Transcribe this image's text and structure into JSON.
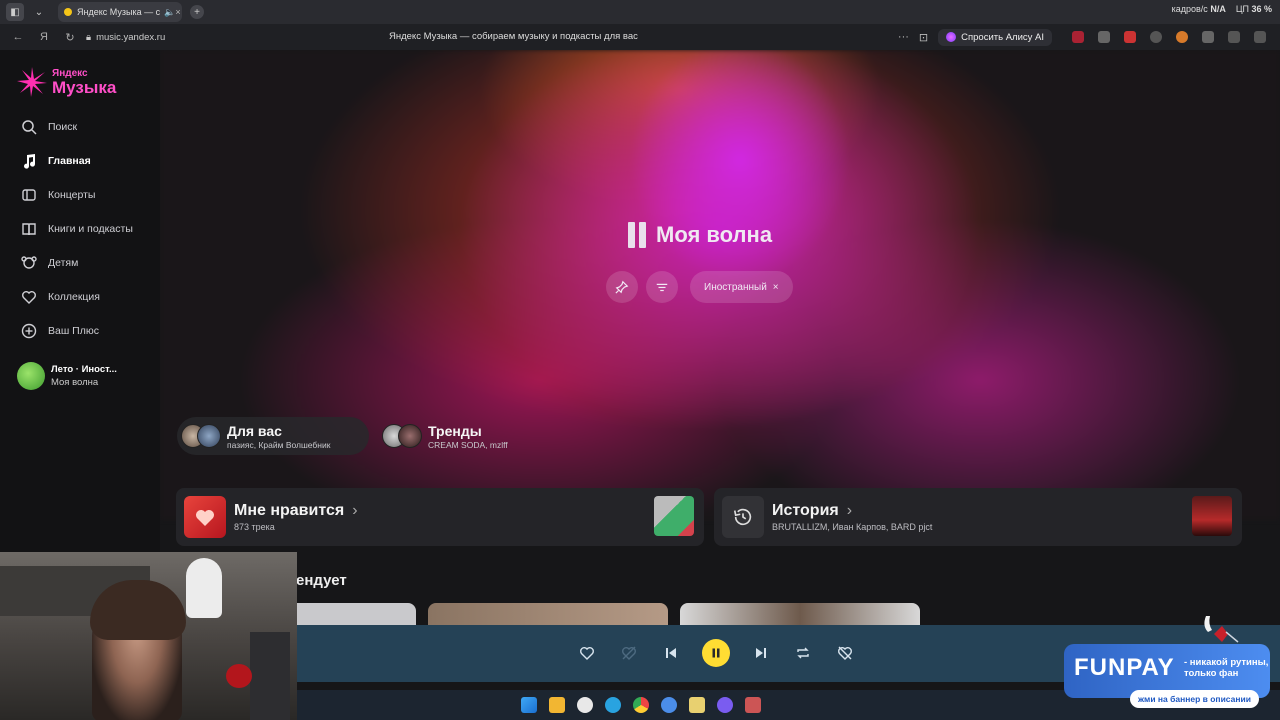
{
  "browser": {
    "tab_title": "Яндекс Музыка — с",
    "new_tab_symbol": "+",
    "sys_fps_label": "кадров/с",
    "sys_fps_value": "N/A",
    "sys_cpu_label": "ЦП",
    "sys_cpu_value": "36 %",
    "url": "music.yandex.ru",
    "page_title": "Яндекс Музыка — собираем музыку и подкасты для вас",
    "more_symbol": "···",
    "ask_alisa": "Спросить Алису AI"
  },
  "logo": {
    "line1": "Яндекс",
    "line2": "Музыка"
  },
  "sidebar": {
    "items": [
      {
        "label": "Поиск",
        "icon": "search-icon",
        "active": false
      },
      {
        "label": "Главная",
        "icon": "music-note-icon",
        "active": true
      },
      {
        "label": "Концерты",
        "icon": "ticket-icon",
        "active": false
      },
      {
        "label": "Книги и подкасты",
        "icon": "book-icon",
        "active": false
      },
      {
        "label": "Детям",
        "icon": "kids-icon",
        "active": false
      },
      {
        "label": "Коллекция",
        "icon": "heart-icon",
        "active": false
      },
      {
        "label": "Ваш Плюс",
        "icon": "plus-icon",
        "active": false
      }
    ],
    "playlist": {
      "title": "Лето · Иност...",
      "subtitle": "Моя волна"
    }
  },
  "wave": {
    "title": "Моя волна",
    "chip": "Иностранный",
    "chip_close": "×"
  },
  "mini_cards": [
    {
      "title": "Для вас",
      "subtitle": "пазияс, Крайм Волшебник"
    },
    {
      "title": "Тренды",
      "subtitle": "CREAM SODA, mzlff"
    }
  ],
  "cards": [
    {
      "title": "Мне нравится",
      "subtitle": "873 трека"
    },
    {
      "title": "История",
      "subtitle": "BRUTALLIZM, Иван Карпов, BARD pjct"
    }
  ],
  "chevron": "›",
  "recommend_partial": "ендует",
  "funpay": {
    "logo": "FUNPAY",
    "tag_line1": "- никакой рутины,",
    "tag_line2": "только фан",
    "button": "жми на баннер в описании"
  },
  "colors": {
    "accent_pink": "#ff4fc8",
    "player_bg": "#254256",
    "play_button": "#ffdd33"
  }
}
